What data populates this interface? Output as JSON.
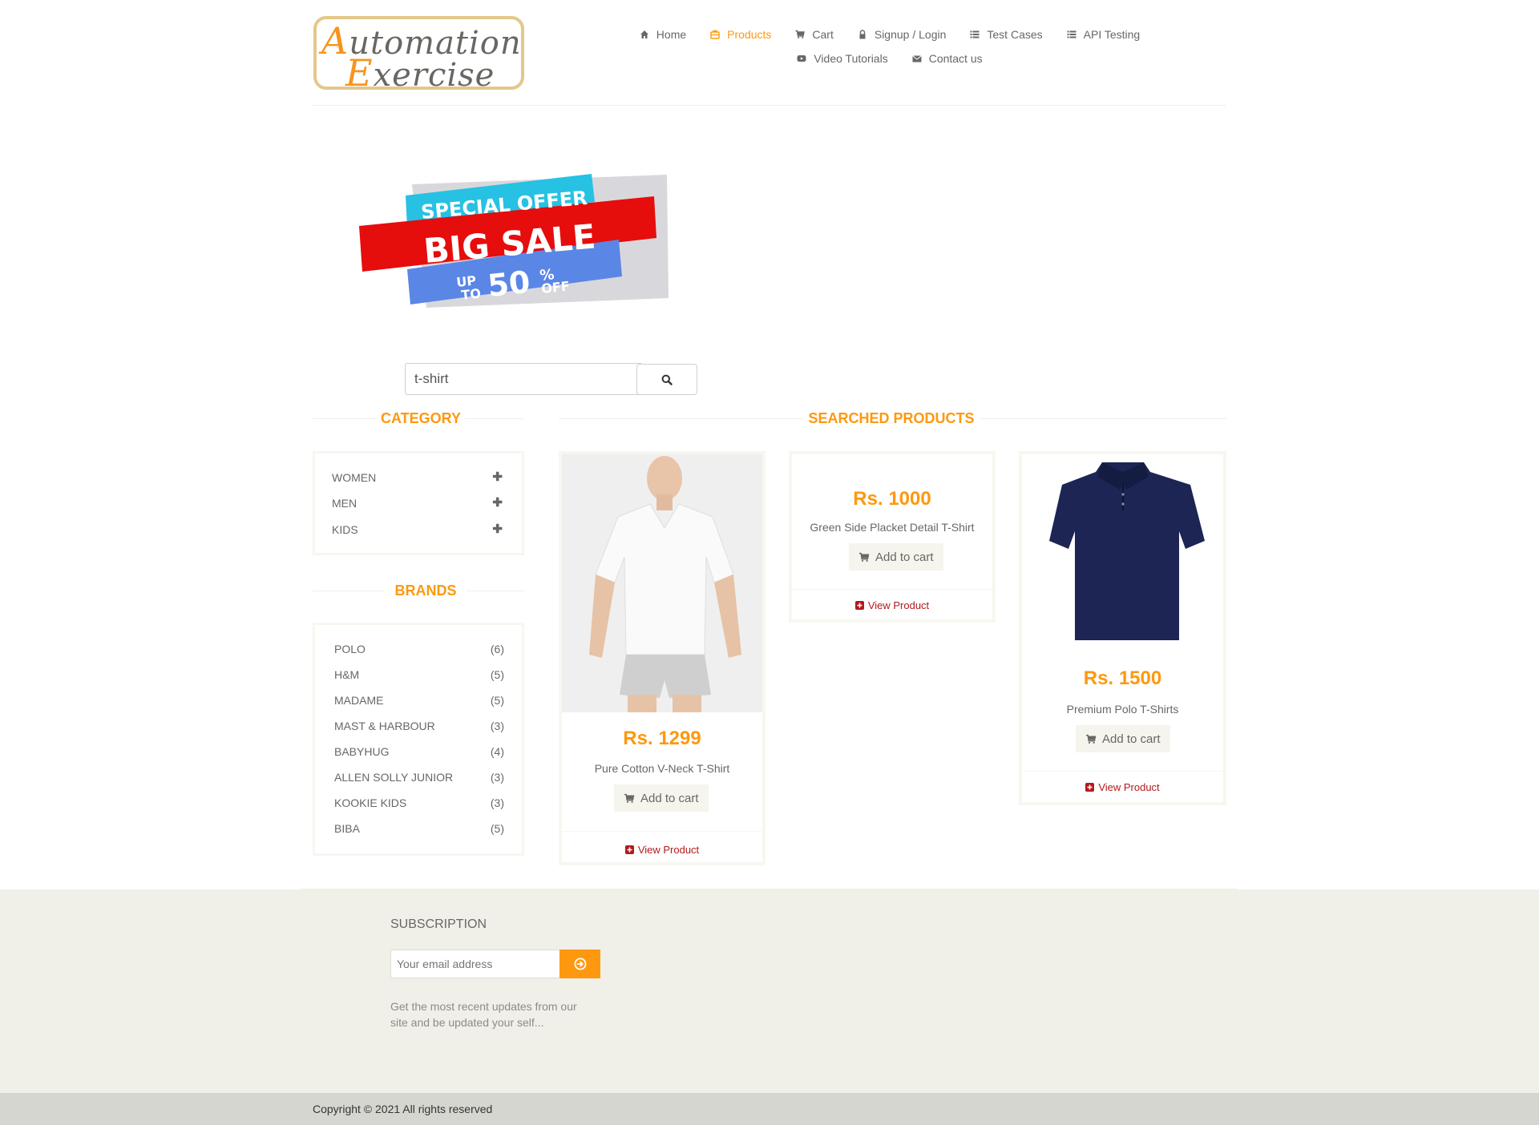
{
  "header": {
    "logo_text_line1": "Automation",
    "logo_text_line2": "Exercise",
    "nav": [
      {
        "label": "Home",
        "icon": "home-icon",
        "active": false
      },
      {
        "label": "Products",
        "icon": "products-icon",
        "active": true
      },
      {
        "label": "Cart",
        "icon": "cart-icon",
        "active": false
      },
      {
        "label": "Signup / Login",
        "icon": "lock-icon",
        "active": false
      },
      {
        "label": "Test Cases",
        "icon": "list-icon",
        "active": false
      },
      {
        "label": "API Testing",
        "icon": "list-icon",
        "active": false
      },
      {
        "label": "Video Tutorials",
        "icon": "youtube-icon",
        "active": false
      },
      {
        "label": "Contact us",
        "icon": "envelope-icon",
        "active": false
      }
    ]
  },
  "banner": {
    "line1": "SPECIAL OFFER",
    "line2": "BIG SALE",
    "line3_up": "UP",
    "line3_to": "TO",
    "line3_pct": "50",
    "line3_sign": "%",
    "line3_off": "OFF"
  },
  "search": {
    "value": "t-shirt",
    "button_icon": "search-icon"
  },
  "sidebar": {
    "category_title": "CATEGORY",
    "categories": [
      {
        "label": "WOMEN"
      },
      {
        "label": "MEN"
      },
      {
        "label": "KIDS"
      }
    ],
    "brands_title": "BRANDS",
    "brands": [
      {
        "label": "POLO",
        "count": "(6)"
      },
      {
        "label": "H&M",
        "count": "(5)"
      },
      {
        "label": "MADAME",
        "count": "(5)"
      },
      {
        "label": "MAST & HARBOUR",
        "count": "(3)"
      },
      {
        "label": "BABYHUG",
        "count": "(4)"
      },
      {
        "label": "ALLEN SOLLY JUNIOR",
        "count": "(3)"
      },
      {
        "label": "KOOKIE KIDS",
        "count": "(3)"
      },
      {
        "label": "BIBA",
        "count": "(5)"
      }
    ]
  },
  "products": {
    "title": "SEARCHED PRODUCTS",
    "add_to_cart": "Add to cart",
    "view_product": "View Product",
    "items": [
      {
        "price": "Rs. 1299",
        "name": "Pure Cotton V-Neck T-Shirt"
      },
      {
        "price": "Rs. 1000",
        "name": "Green Side Placket Detail T-Shirt"
      },
      {
        "price": "Rs. 1500",
        "name": "Premium Polo T-Shirts"
      }
    ]
  },
  "footer": {
    "subscription_title": "SUBSCRIPTION",
    "email_placeholder": "Your email address",
    "description": "Get the most recent updates from our site and be updated your self...",
    "copyright": "Copyright © 2021 All rights reserved"
  },
  "colors": {
    "accent": "#fe980f",
    "text": "#696763",
    "link_red": "#b3191b",
    "panel_border": "#f7f7f0",
    "footer_bg": "#f0f0e9"
  }
}
